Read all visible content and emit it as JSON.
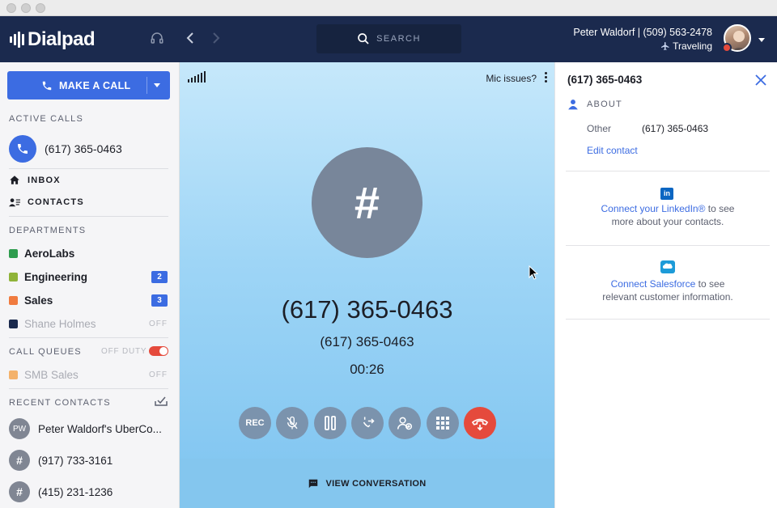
{
  "app": {
    "brand": "Dialpad"
  },
  "header": {
    "search_placeholder": "SEARCH",
    "user_line": "Peter Waldorf | (509) 563-2478",
    "status": "Traveling"
  },
  "sidebar": {
    "make_call_label": "MAKE A CALL",
    "active_calls_title": "ACTIVE CALLS",
    "active_call_number": "(617) 365-0463",
    "nav": [
      {
        "label": "INBOX"
      },
      {
        "label": "CONTACTS"
      }
    ],
    "departments_title": "DEPARTMENTS",
    "departments": [
      {
        "name": "AeroLabs",
        "color": "#2e9c4e",
        "badge": ""
      },
      {
        "name": "Engineering",
        "color": "#8fb339",
        "badge": "2"
      },
      {
        "name": "Sales",
        "color": "#f07b3f",
        "badge": "3"
      },
      {
        "name": "Shane Holmes",
        "color": "#1b2a4e",
        "off": "OFF"
      }
    ],
    "call_queues_title": "CALL QUEUES",
    "off_duty_label": "OFF DUTY",
    "queues": [
      {
        "name": "SMB Sales",
        "color": "#f4b26b",
        "off": "OFF"
      }
    ],
    "recent_contacts_title": "RECENT CONTACTS",
    "recent_contacts": [
      {
        "initials": "PW",
        "name": "Peter Waldorf's UberCo..."
      },
      {
        "initials": "#",
        "name": "(917) 733-3161"
      },
      {
        "initials": "#",
        "name": "(415) 231-1236"
      }
    ]
  },
  "call": {
    "mic_issues": "Mic issues?",
    "avatar_glyph": "#",
    "number": "(617) 365-0463",
    "sub_number": "(617) 365-0463",
    "timer": "00:26",
    "rec_label": "REC",
    "view_conversation": "VIEW CONVERSATION"
  },
  "details": {
    "title": "(617) 365-0463",
    "about_title": "ABOUT",
    "field_label": "Other",
    "field_value": "(617) 365-0463",
    "edit_contact": "Edit contact",
    "linkedin_link": "Connect your LinkedIn®",
    "linkedin_rest_1": " to see",
    "linkedin_rest_2": "more about your contacts.",
    "salesforce_link": "Connect Salesforce",
    "salesforce_rest_1": " to see",
    "salesforce_rest_2": "relevant customer information."
  },
  "colors": {
    "header_bg": "#1b2a4e",
    "accent": "#3c6ce2",
    "hangup": "#e54a3c",
    "call_bg": "#9ed5f6"
  }
}
